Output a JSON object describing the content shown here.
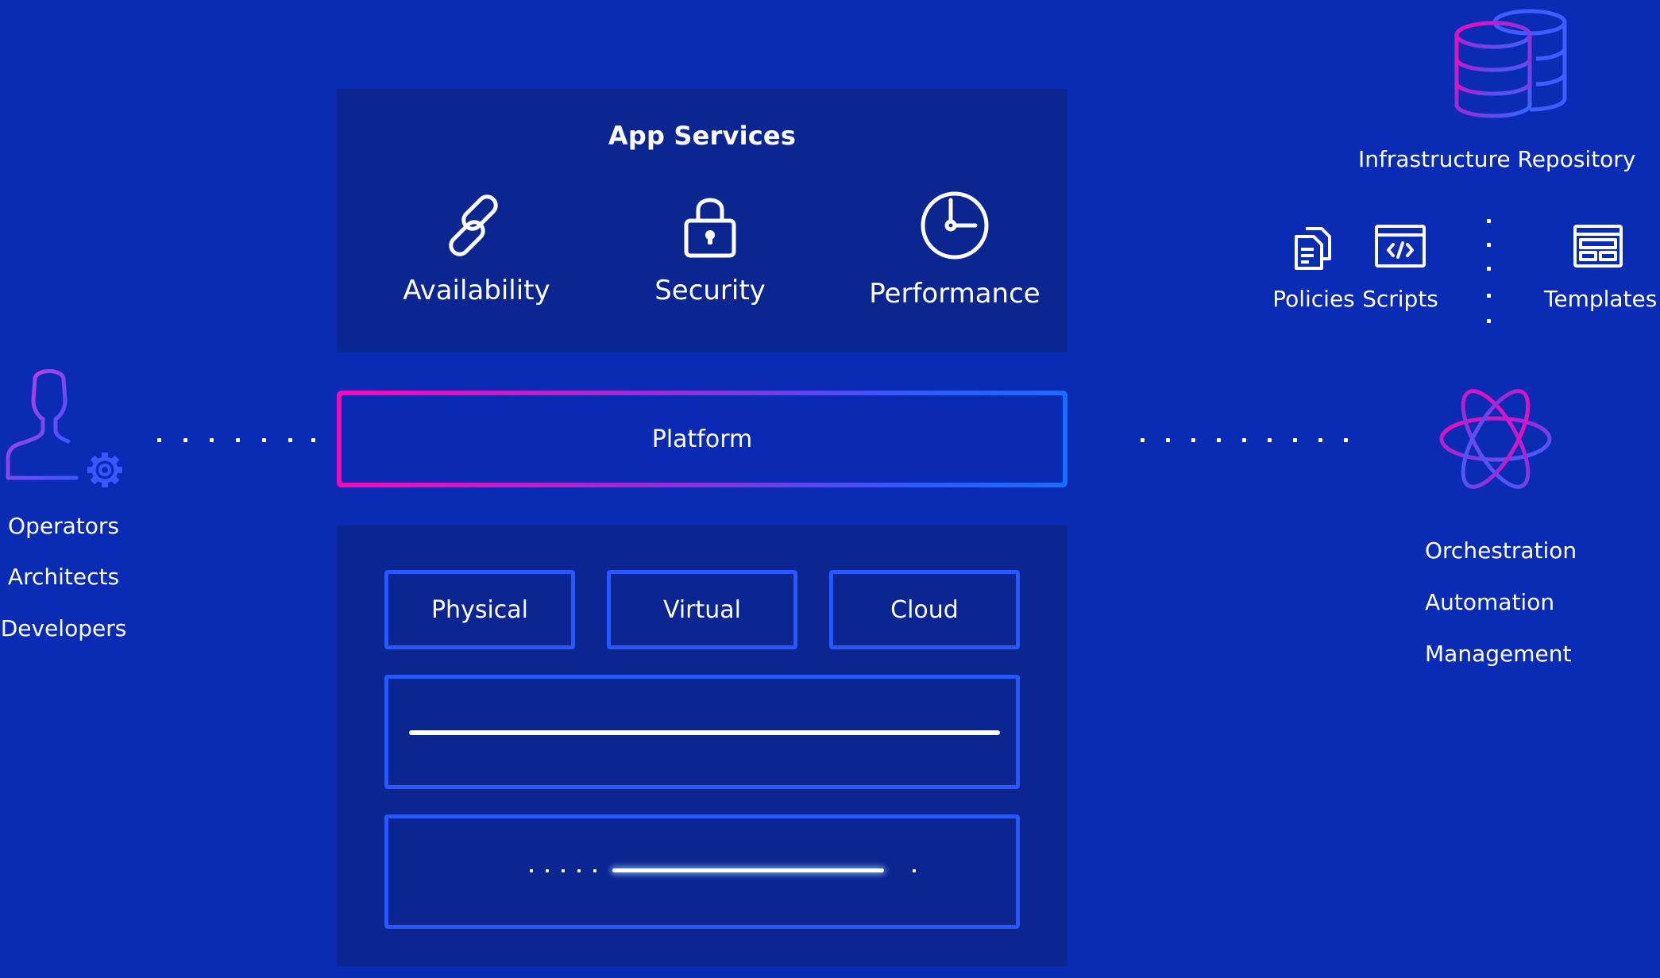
{
  "users": {
    "icon": "user-gear-icon",
    "roles": [
      "Operators",
      "Architects",
      "Developers"
    ]
  },
  "app_services": {
    "title": "App Services",
    "items": [
      {
        "label": "Availability",
        "icon": "link-icon"
      },
      {
        "label": "Security",
        "icon": "lock-icon"
      },
      {
        "label": "Performance",
        "icon": "clock-icon"
      }
    ]
  },
  "platform": {
    "label": "Platform"
  },
  "infrastructure": {
    "items": [
      {
        "label": "Physical"
      },
      {
        "label": "Virtual"
      },
      {
        "label": "Cloud"
      }
    ]
  },
  "repository": {
    "title": "Infrastructure Repository",
    "icon": "database-icon",
    "items": [
      {
        "label": "Policies",
        "icon": "documents-icon"
      },
      {
        "label": "Scripts",
        "icon": "code-window-icon"
      },
      {
        "label": "Templates",
        "icon": "template-icon"
      }
    ]
  },
  "orchestration": {
    "icon": "atom-icon",
    "capabilities": [
      "Orchestration",
      "Automation",
      "Management"
    ]
  },
  "colors": {
    "background": "#0a2cb5",
    "panel": "#0b2591",
    "accent_blue": "#2757ff",
    "gradient_pink": "#ff06b8",
    "gradient_blue": "#1a6cff"
  }
}
